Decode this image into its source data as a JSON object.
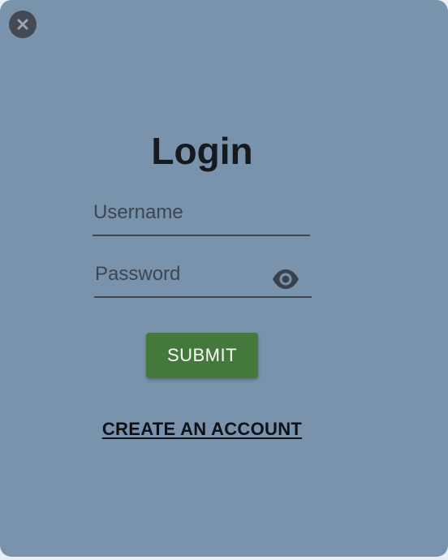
{
  "modal": {
    "close_icon": "close-icon",
    "title": "Login",
    "username": {
      "placeholder": "Username",
      "value": ""
    },
    "password": {
      "placeholder": "Password",
      "value": "",
      "visibility_icon": "eye-icon"
    },
    "submit_label": "SUBMIT",
    "create_account_label": "CREATE AN ACCOUNT"
  },
  "colors": {
    "modal_background": "#7a93ad",
    "submit_button": "#437a3c",
    "title_text": "#151a1f",
    "close_button": "#434a53"
  }
}
